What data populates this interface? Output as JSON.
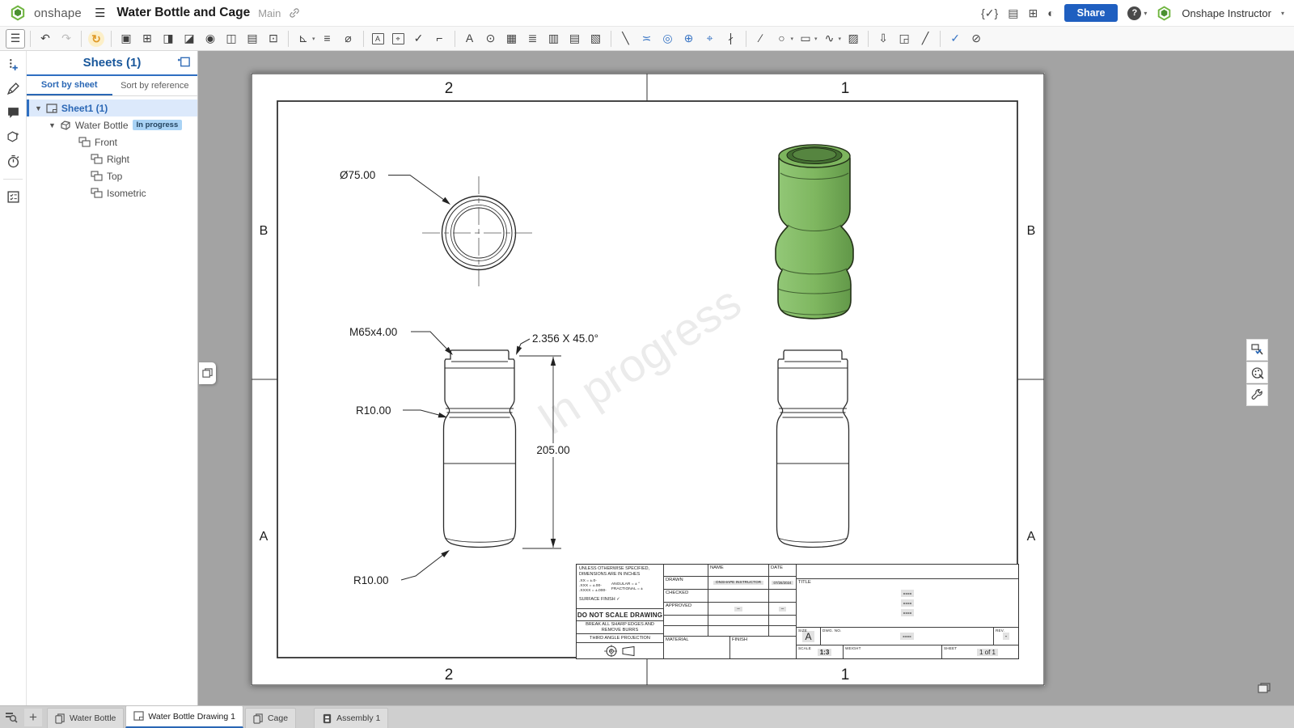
{
  "header": {
    "logo_text": "onshape",
    "hamburger_icon": "☰",
    "title": "Water Bottle and Cage",
    "workspace": "Main",
    "featurescript_icon": "{✓}",
    "doc_list_icon": "▤",
    "grid_plus_icon": "⊞",
    "theme_icon": "◐",
    "share_label": "Share",
    "help_glyph": "?",
    "caret_glyph": "▾",
    "user_name": "Onshape Instructor"
  },
  "colors": {
    "accent_blue": "#2a67b5",
    "share_button_blue": "#1f5fc0",
    "selection_blue": "#2f6fc2",
    "badge_blue": "#a9d3f5",
    "bottle_green": "#7fb760",
    "paper_white": "#ffffff",
    "canvas_gray": "#a3a3a3"
  },
  "toolbar": {
    "icons": [
      {
        "name": "sheets-panel-toggle-icon",
        "glyph": "☰",
        "pressed": true,
        "sep": true
      },
      {
        "name": "undo-icon",
        "glyph": "↶"
      },
      {
        "name": "redo-icon",
        "glyph": "↷",
        "muted": true,
        "sep": true
      },
      {
        "name": "update-views-icon",
        "glyph": "↻",
        "orange": true,
        "sep": true
      },
      {
        "name": "insert-view-icon",
        "glyph": "▣"
      },
      {
        "name": "projected-view-icon",
        "glyph": "⊞"
      },
      {
        "name": "auxiliary-view-icon",
        "glyph": "◨"
      },
      {
        "name": "section-view-icon",
        "glyph": "◪"
      },
      {
        "name": "detail-view-icon",
        "glyph": "◉"
      },
      {
        "name": "broken-view-icon",
        "glyph": "◫"
      },
      {
        "name": "break-out-section-icon",
        "glyph": "▤"
      },
      {
        "name": "crop-view-icon",
        "glyph": "⊡",
        "sep": true
      },
      {
        "name": "dimension-icon",
        "glyph": "⊾",
        "caret": true
      },
      {
        "name": "ordinate-dimension-icon",
        "glyph": "≡"
      },
      {
        "name": "diameter-dimension-icon",
        "glyph": "⌀",
        "sep": true
      },
      {
        "name": "dimension-frame-icon",
        "glyph": "A",
        "boxed": true
      },
      {
        "name": "geometric-tolerance-icon",
        "glyph": "⌖",
        "boxed": true
      },
      {
        "name": "surface-finish-symbol-icon",
        "glyph": "✓"
      },
      {
        "name": "weld-symbol-icon",
        "glyph": "⌐",
        "sep": true
      },
      {
        "name": "note-icon",
        "glyph": "A"
      },
      {
        "name": "balloon-icon",
        "glyph": "⊙"
      },
      {
        "name": "table-icon",
        "glyph": "▦"
      },
      {
        "name": "bom-table-icon",
        "glyph": "≣"
      },
      {
        "name": "hole-table-icon",
        "glyph": "▥"
      },
      {
        "name": "revision-table-icon",
        "glyph": "▤"
      },
      {
        "name": "cut-list-icon",
        "glyph": "▧",
        "sep": true
      },
      {
        "name": "callout-icon",
        "glyph": "╲"
      },
      {
        "name": "centerline-icon",
        "glyph": "≍",
        "blue": true
      },
      {
        "name": "circular-centermark-icon",
        "glyph": "◎",
        "blue": true
      },
      {
        "name": "centermark-icon",
        "glyph": "⊕",
        "blue": true
      },
      {
        "name": "center-target-icon",
        "glyph": "⌖",
        "blue": true
      },
      {
        "name": "tangent-line-icon",
        "glyph": "∤",
        "sep": true
      },
      {
        "name": "sketch-line-icon",
        "glyph": "∕"
      },
      {
        "name": "sketch-circle-icon",
        "glyph": "○",
        "caret": true
      },
      {
        "name": "sketch-rectangle-icon",
        "glyph": "▭",
        "caret": true
      },
      {
        "name": "sketch-spline-icon",
        "glyph": "∿",
        "caret": true
      },
      {
        "name": "hatch-icon",
        "glyph": "▨",
        "sep": true
      },
      {
        "name": "export-dxf-icon",
        "glyph": "⇩"
      },
      {
        "name": "insert-image-icon",
        "glyph": "◲"
      },
      {
        "name": "line-style-icon",
        "glyph": "╱",
        "sep": true
      },
      {
        "name": "verify-dimensions-icon",
        "glyph": "✓",
        "blue": true
      },
      {
        "name": "measure-icon",
        "glyph": "⊘"
      }
    ]
  },
  "sheets_panel": {
    "title": "Sheets (1)",
    "tabs": [
      {
        "label": "Sort by sheet",
        "active": true
      },
      {
        "label": "Sort by reference",
        "active": false
      }
    ],
    "tree": {
      "sheet_label": "Sheet1 (1)",
      "drawing_label": "Water Bottle",
      "status_badge": "In progress",
      "views": [
        "Front",
        "Right",
        "Top",
        "Isometric"
      ]
    }
  },
  "drawing": {
    "watermark": "In progress",
    "zones": {
      "top": [
        "2",
        "1"
      ],
      "bottom": [
        "2",
        "1"
      ],
      "left": [
        "B",
        "A"
      ],
      "right": [
        "B",
        "A"
      ]
    },
    "dimensions": {
      "top_view_diameter": "Ø75.00",
      "thread": "M65x4.00",
      "chamfer": "2.356 X 45.0°",
      "waist_radius": "R10.00",
      "height": "205.00",
      "bottom_radius": "R10.00"
    },
    "title_block": {
      "notes_line1": "UNLESS OTHERWISE SPECIFIED,",
      "notes_line2": "DIMENSIONS ARE IN INCHES",
      "tol_xx": ".XX = ±.0-",
      "tol_xxx": ".XXX = ±.00-",
      "tol_xxxx": ".XXXX = ±.000-",
      "tol_angular": "ANGULAR = ± °",
      "tol_fractional": "FRACTIONAL = ±",
      "surface_finish_label": "SURFACE FINISH",
      "surface_finish_check": "✓",
      "do_not_scale": "DO NOT SCALE DRAWING",
      "break_edges_line1": "BREAK ALL SHARP EDGES AND",
      "break_edges_line2": "REMOVE BURRS",
      "projection_label": "THIRD ANGLE PROJECTION",
      "name_header": "NAME",
      "date_header": "DATE",
      "drawn_label": "DRAWN",
      "drawn_name": "ONSHAPE INSTRUCTOR",
      "drawn_date": "07/26/2024",
      "checked_label": "CHECKED",
      "approved_label": "APPROVED",
      "approved_name_placeholder": "–",
      "approved_date_placeholder": "–",
      "material_label": "MATERIAL",
      "finish_label": "FINISH",
      "title_label": "TITLE",
      "title_value_1": "----",
      "title_value_2": "----",
      "title_value_3": "----",
      "size_label": "SIZE",
      "size_value": "A",
      "dwg_label": "DWG. NO.",
      "dwg_value": "----",
      "rev_label": "REV.",
      "rev_value": "-",
      "scale_label": "SCALE",
      "scale_value": "1:3",
      "weight_label": "WEIGHT",
      "sheet_label": "SHEET",
      "sheet_value": "1 of 1"
    }
  },
  "bottom_bar": {
    "add_tab_glyph": "+",
    "tabs": [
      {
        "label": "Water Bottle",
        "type": "part-studio"
      },
      {
        "label": "Water Bottle Drawing 1",
        "type": "drawing",
        "active": true
      },
      {
        "label": "Cage",
        "type": "part-studio"
      },
      {
        "label": "Assembly 1",
        "type": "assembly"
      }
    ]
  }
}
